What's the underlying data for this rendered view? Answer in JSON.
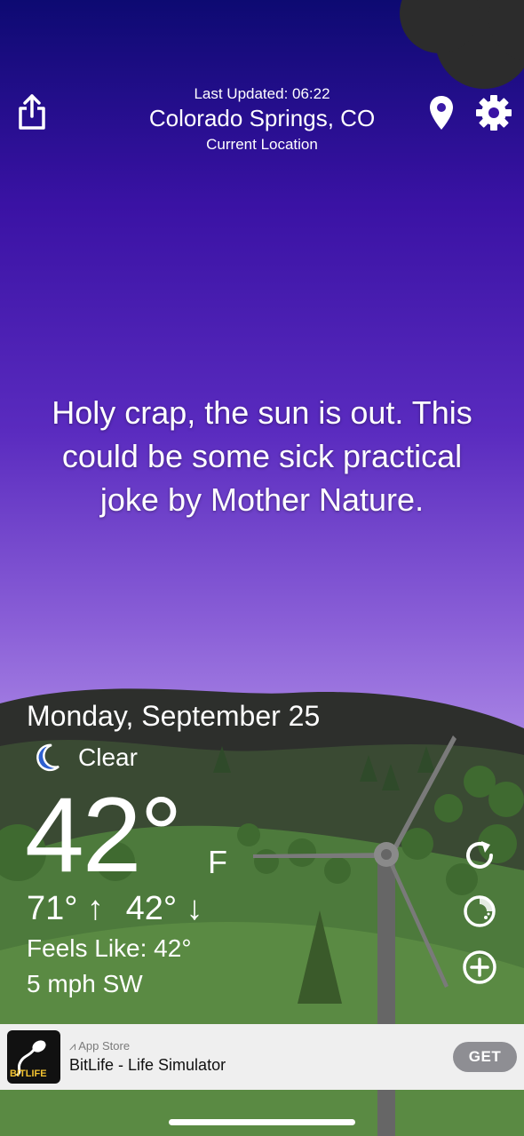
{
  "header": {
    "last_updated": "Last Updated: 06:22",
    "city": "Colorado Springs, CO",
    "location_label": "Current Location",
    "icons": [
      "share-icon",
      "location-pin-icon",
      "gear-icon"
    ]
  },
  "quote": "Holy crap, the sun is out. This could be some sick practical joke by Mother Nature.",
  "weather": {
    "date": "Monday, September 25",
    "condition": "Clear",
    "condition_icon": "moon-icon",
    "temperature": "42°",
    "unit": "F",
    "high": "71° ↑",
    "low": "42° ↓",
    "feels_like": "Feels Like: 42°",
    "wind": "5 mph SW"
  },
  "side_buttons": [
    "refresh-icon",
    "radar-icon",
    "add-icon"
  ],
  "ad": {
    "store": "App Store",
    "title": "BitLife - Life Simulator",
    "icon_text": "BITLIFE",
    "button": "GET"
  },
  "colors": {
    "sky_top": "#0d0a72",
    "sky_bottom": "#c3a6ef",
    "hills": "#3e5a35",
    "ad_background": "#efefef",
    "get_button": "#8e8e93"
  }
}
